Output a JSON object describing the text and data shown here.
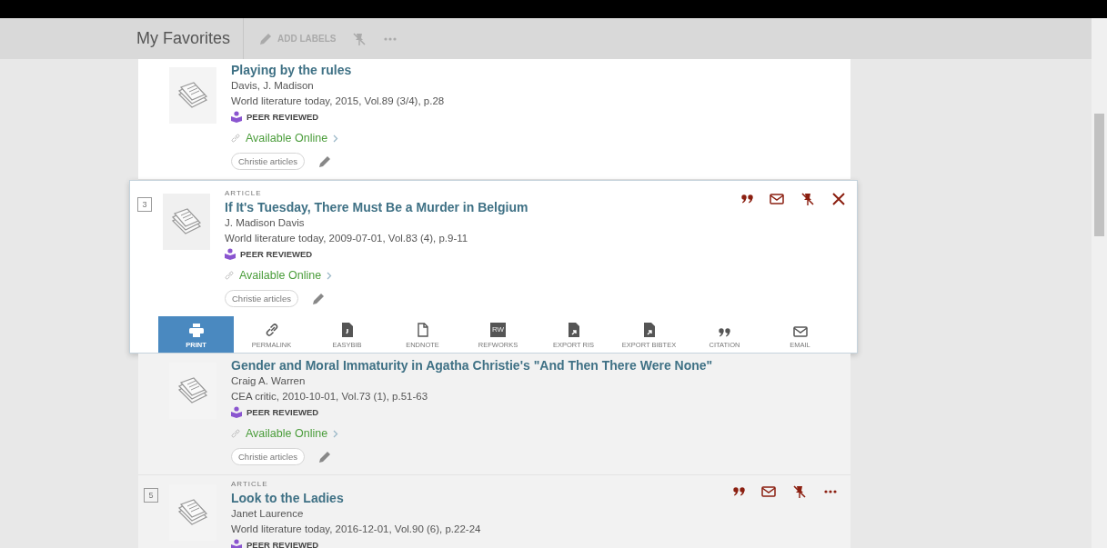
{
  "header": {
    "title": "My Favorites",
    "actions": [
      {
        "kind": "labels",
        "label": "ADD LABELS"
      },
      {
        "kind": "unpin"
      },
      {
        "kind": "more"
      }
    ]
  },
  "records": [
    {
      "title": "Playing by the rules",
      "author": "Davis, J. Madison",
      "source": "World literature today, 2015, Vol.89 (3/4), p.28",
      "badge": "PEER REVIEWED",
      "availability": "Available Online",
      "labels": [
        "Christie articles"
      ],
      "expanded": false
    },
    {
      "number": "3",
      "type": "ARTICLE",
      "title": "If It's Tuesday, There Must Be a Murder in Belgium",
      "author": "J. Madison Davis",
      "source": "World literature today, 2009-07-01, Vol.83 (4), p.9-11",
      "badge": "PEER REVIEWED",
      "availability": "Available Online",
      "labels": [
        "Christie articles"
      ],
      "expanded": true,
      "actions": [
        {
          "kind": "citation"
        },
        {
          "kind": "email"
        },
        {
          "kind": "unpin"
        },
        {
          "kind": "close"
        }
      ],
      "toolbar": [
        {
          "kind": "print",
          "label": "PRINT",
          "selected": true
        },
        {
          "kind": "permalink",
          "label": "PERMALINK",
          "selected": false
        },
        {
          "kind": "easybib",
          "label": "EASYBIB",
          "selected": false
        },
        {
          "kind": "endnote",
          "label": "ENDNOTE",
          "selected": false
        },
        {
          "kind": "refworks",
          "label": "REFWORKS",
          "badge": "RW",
          "selected": false
        },
        {
          "kind": "export",
          "label": "EXPORT RIS",
          "selected": false
        },
        {
          "kind": "export",
          "label": "EXPORT BIBTEX",
          "selected": false
        },
        {
          "kind": "citation",
          "label": "CITATION",
          "selected": false
        },
        {
          "kind": "email",
          "label": "EMAIL",
          "selected": false
        }
      ]
    },
    {
      "title": "Gender and Moral Immaturity in Agatha Christie's \"And Then There Were None\"",
      "author": "Craig A. Warren",
      "source": "CEA critic, 2010-10-01, Vol.73 (1), p.51-63",
      "badge": "PEER REVIEWED",
      "availability": "Available Online",
      "labels": [
        "Christie articles"
      ],
      "expanded": false
    },
    {
      "number": "5",
      "type": "ARTICLE",
      "title": "Look to the Ladies",
      "author": "Janet Laurence",
      "source": "World literature today, 2016-12-01, Vol.90 (6), p.22-24",
      "badge": "PEER REVIEWED",
      "expanded": false,
      "actions": [
        {
          "kind": "citation"
        },
        {
          "kind": "email"
        },
        {
          "kind": "unpin"
        },
        {
          "kind": "more"
        }
      ]
    }
  ]
}
